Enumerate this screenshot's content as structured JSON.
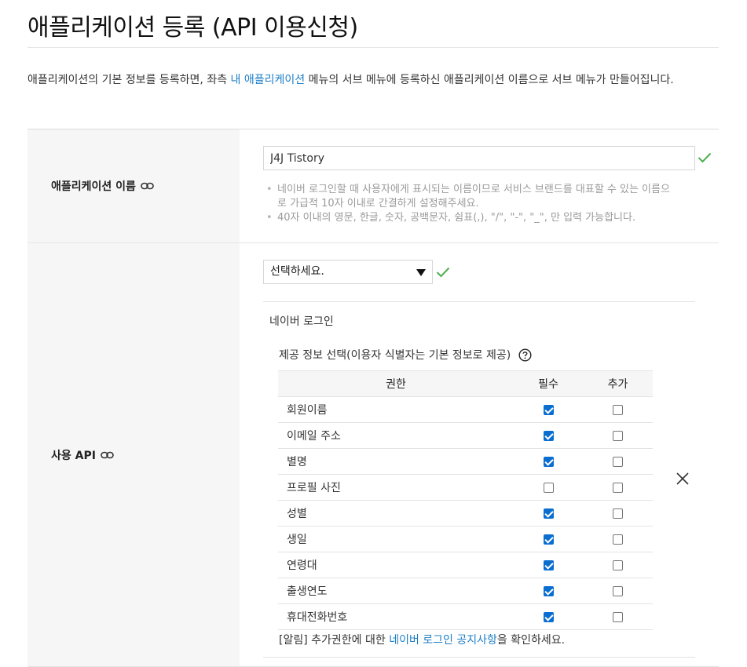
{
  "page": {
    "title": "애플리케이션 등록 (API 이용신청)",
    "intro_before": "애플리케이션의 기본 정보를 등록하면, 좌측 ",
    "intro_link": "내 애플리케이션",
    "intro_after": " 메뉴의 서브 메뉴에 등록하신 애플리케이션 이름으로 서브 메뉴가 만들어집니다."
  },
  "app_name_row": {
    "label": "애플리케이션 이름",
    "value": "J4J Tistory",
    "hints": [
      "네이버 로그인할 때 사용자에게 표시되는 이름이므로 서비스 브랜드를 대표할 수 있는 이름으로 가급적 10자 이내로 간결하게 설정해주세요.",
      "40자 이내의 영문, 한글, 숫자, 공백문자, 쉼표(,), \"/\", \"-\", \"_\", 만 입력 가능합니다."
    ]
  },
  "api_row": {
    "label": "사용 API",
    "select_value": "선택하세요.",
    "api_name": "네이버 로그인",
    "perm_heading": "제공 정보 선택(이용자 식별자는 기본 정보로 제공)",
    "columns": {
      "name": "권한",
      "required": "필수",
      "additional": "추가"
    },
    "permissions": [
      {
        "name": "회원이름",
        "required": true,
        "additional": false
      },
      {
        "name": "이메일 주소",
        "required": true,
        "additional": false
      },
      {
        "name": "별명",
        "required": true,
        "additional": false
      },
      {
        "name": "프로필 사진",
        "required": false,
        "additional": false
      },
      {
        "name": "성별",
        "required": true,
        "additional": false
      },
      {
        "name": "생일",
        "required": true,
        "additional": false
      },
      {
        "name": "연령대",
        "required": true,
        "additional": false
      },
      {
        "name": "출생연도",
        "required": true,
        "additional": false
      },
      {
        "name": "휴대전화번호",
        "required": true,
        "additional": false
      }
    ],
    "notice_before": "[알림] 추가권한에 대한 ",
    "notice_link": "네이버 로그인 공지사항",
    "notice_after": "을 확인하세요."
  },
  "colors": {
    "link": "#1d7ec6",
    "check_green": "#4caf50",
    "checkbox_on": "#0a6ed1",
    "label_bg": "#f6f6f6"
  },
  "icons": [
    "link-icon",
    "check-icon",
    "help-icon",
    "close-icon",
    "caret-down-icon"
  ]
}
